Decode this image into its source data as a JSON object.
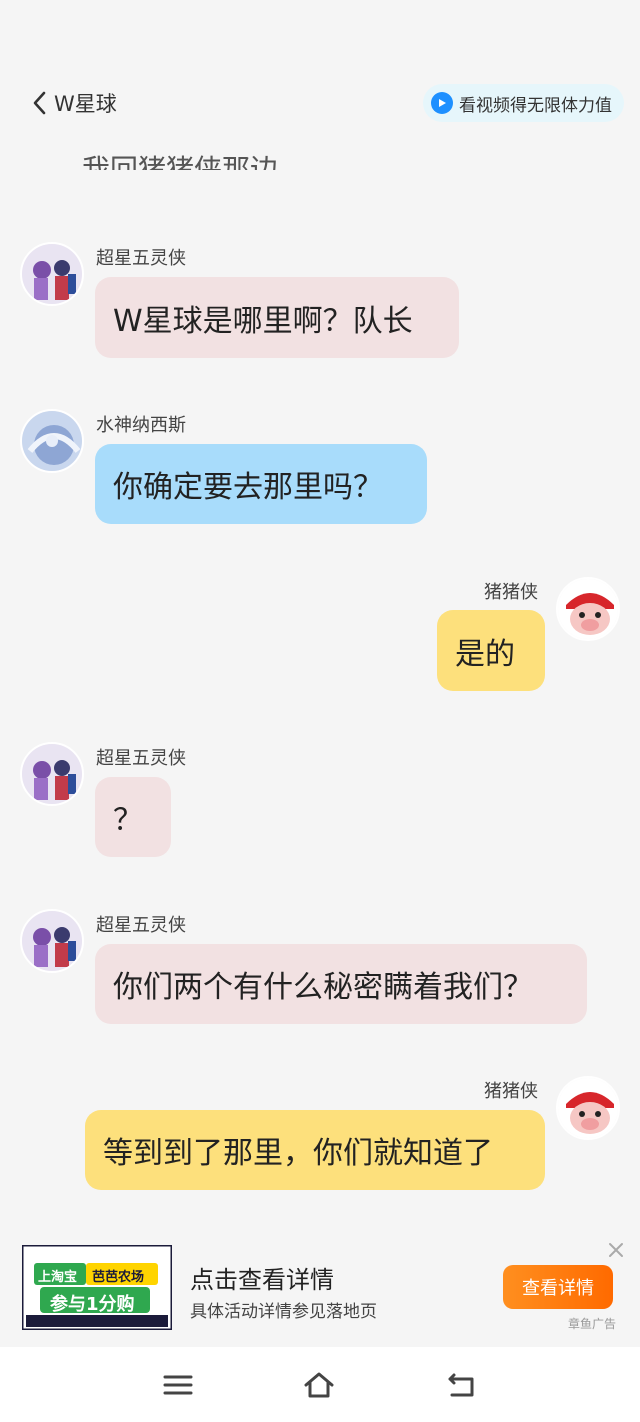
{
  "header": {
    "title": "W星球",
    "promo_label": "看视频得无限体力值"
  },
  "partial_message": "我回猪猪侠那边",
  "messages": [
    {
      "sender": "超星五灵侠",
      "text": "W星球是哪里啊？队长",
      "side": "left",
      "color": "#f2e1e2"
    },
    {
      "sender": "水神纳西斯",
      "text": "你确定要去那里吗？",
      "side": "left",
      "color": "#a8dcfb"
    },
    {
      "sender": "猪猪侠",
      "text": "是的",
      "side": "right",
      "color": "#fde07c"
    },
    {
      "sender": "超星五灵侠",
      "text": "？",
      "side": "left",
      "color": "#f2e1e2"
    },
    {
      "sender": "超星五灵侠",
      "text": "你们两个有什么秘密瞒着我们？",
      "side": "left",
      "color": "#f2e1e2"
    },
    {
      "sender": "猪猪侠",
      "text": "等到到了那里，你们就知道了",
      "side": "right",
      "color": "#fde07c"
    }
  ],
  "ad": {
    "image_text_1": "上淘宝",
    "image_text_2": "芭芭农场",
    "image_text_3": "参与1分购",
    "title": "点击查看详情",
    "subtitle": "具体活动详情参见落地页",
    "button": "查看详情",
    "tag": "章鱼广告"
  },
  "icons": {
    "back": "chevron-left-icon",
    "play": "play-icon",
    "close": "close-icon",
    "menu": "menu-icon",
    "home": "home-icon",
    "return": "return-icon"
  }
}
